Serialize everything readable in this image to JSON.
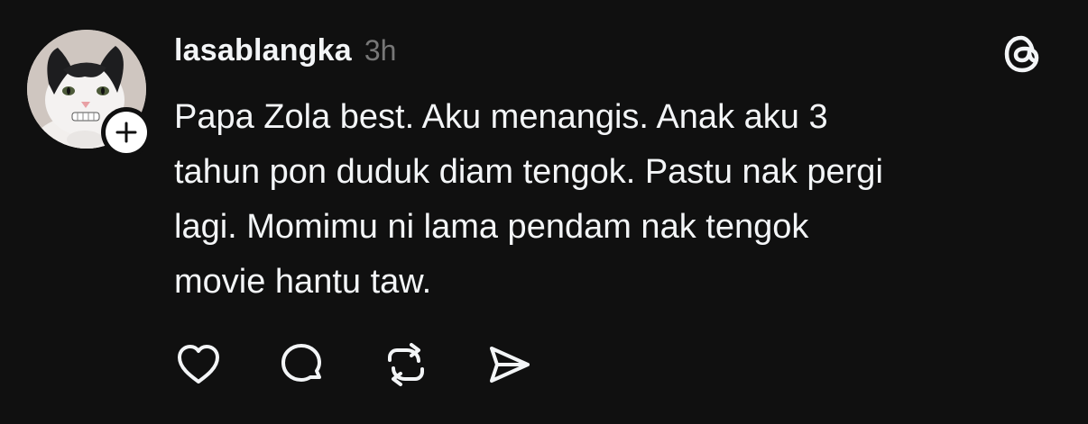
{
  "post": {
    "username": "lasablangka",
    "timestamp": "3h",
    "text": "Papa Zola best. Aku menangis. Anak aku 3\ntahun pon duduk diam tengok. Pastu nak pergi\nlagi. Momimu ni lama pendam nak tengok\nmovie hantu taw.",
    "avatar_icon": "cat-avatar",
    "follow_icon": "plus-icon",
    "logo_icon": "threads-logo-icon"
  },
  "actions": [
    {
      "name": "like",
      "icon": "heart-icon"
    },
    {
      "name": "reply",
      "icon": "comment-icon"
    },
    {
      "name": "repost",
      "icon": "repost-icon"
    },
    {
      "name": "share",
      "icon": "send-icon"
    }
  ],
  "colors": {
    "background": "#101010",
    "text_primary": "#f3f5f7",
    "text_secondary": "#777777",
    "icon": "#f3f5f7"
  }
}
